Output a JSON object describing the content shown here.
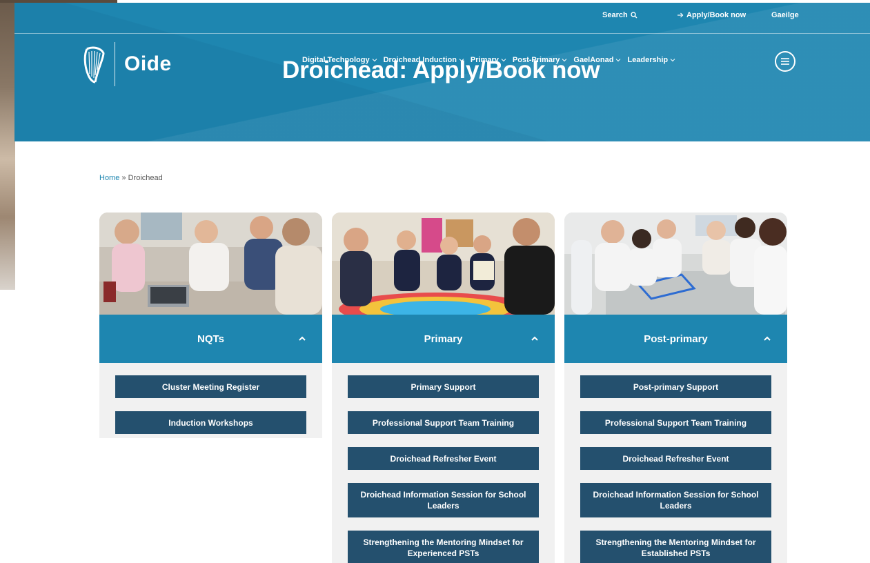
{
  "topbar": {
    "search_label": "Search",
    "apply_label": "Apply/Book now",
    "language_label": "Gaeilge"
  },
  "logo": {
    "text": "Oide"
  },
  "header": {
    "title": "Droichead: Apply/Book now"
  },
  "nav": {
    "items": [
      {
        "label": "Digital Technology"
      },
      {
        "label": "Droichead Induction"
      },
      {
        "label": "Primary"
      },
      {
        "label": "Post-Primary"
      },
      {
        "label": "GaelAonad"
      },
      {
        "label": "Leadership"
      }
    ]
  },
  "breadcrumb": {
    "home": "Home",
    "separator": "»",
    "current": "Droichead"
  },
  "cards": [
    {
      "title": "NQTs",
      "buttons": [
        {
          "label": "Cluster Meeting Register"
        },
        {
          "label": "Induction Workshops"
        }
      ]
    },
    {
      "title": "Primary",
      "buttons": [
        {
          "label": "Primary Support"
        },
        {
          "label": "Professional Support Team Training"
        },
        {
          "label": "Droichead Refresher Event"
        },
        {
          "label": "Droichead Information Session for School Leaders"
        },
        {
          "label": "Strengthening the Mentoring Mindset for Experienced PSTs"
        }
      ]
    },
    {
      "title": "Post-primary",
      "buttons": [
        {
          "label": "Post-primary Support"
        },
        {
          "label": "Professional Support Team Training"
        },
        {
          "label": "Droichead Refresher Event"
        },
        {
          "label": "Droichead Information Session for School Leaders"
        },
        {
          "label": "Strengthening the Mentoring Mindset for Established PSTs"
        }
      ]
    }
  ],
  "colors": {
    "brand_blue": "#1e86b0",
    "button_navy": "#24506e",
    "panel_grey": "#f1f1f1"
  },
  "icons": {
    "search": "search-icon",
    "arrow": "arrow-right-icon",
    "nav_chevron": "chevron-down-icon",
    "card_chevron": "chevron-up-icon",
    "menu": "hamburger-menu-icon",
    "logo": "harp-logo-icon"
  }
}
